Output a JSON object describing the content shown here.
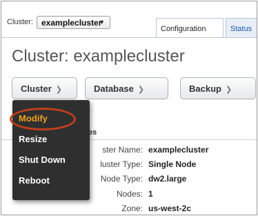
{
  "header": {
    "cluster_label": "Cluster:",
    "cluster_selected": "examplecluster",
    "tabs": [
      {
        "label": "Configuration",
        "active": true
      },
      {
        "label": "Status",
        "active": false
      }
    ]
  },
  "page_title": "Cluster: examplecluster",
  "toolbar": {
    "cluster_button": "Cluster",
    "database_button": "Database",
    "backup_button": "Backup"
  },
  "menu": {
    "items": [
      {
        "label": "Modify",
        "highlighted": true
      },
      {
        "label": "Resize",
        "highlighted": false
      },
      {
        "label": "Shut Down",
        "highlighted": false
      },
      {
        "label": "Reboot",
        "highlighted": false
      }
    ]
  },
  "properties": {
    "section_title": "rties",
    "rows": [
      {
        "label": "ster Name:",
        "value": "examplecluster"
      },
      {
        "label": "luster Type:",
        "value": "Single Node"
      },
      {
        "label": "Node Type:",
        "value": "dw2.large"
      },
      {
        "label": "Nodes:",
        "value": "1"
      },
      {
        "label": "Zone:",
        "value": "us-west-2c"
      }
    ]
  },
  "colors": {
    "highlight_ring": "#c2401c",
    "menu_background": "#2f2f2f",
    "menu_selected_text": "#f0a11f"
  }
}
